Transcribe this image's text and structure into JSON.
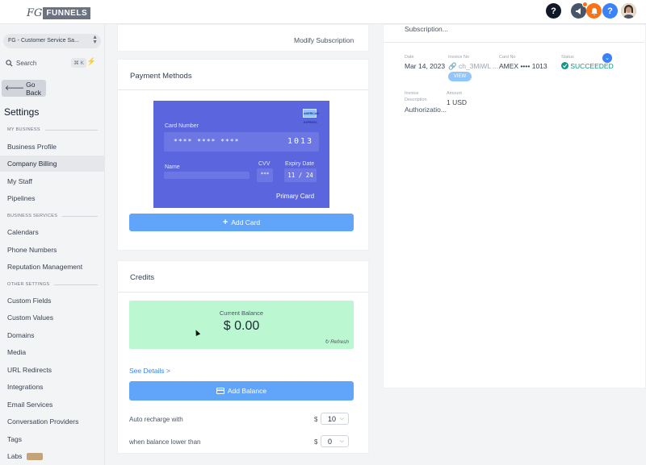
{
  "header": {
    "logo_fg": "FG",
    "logo_text": "FUNNELS",
    "help_icon": "?",
    "megaphone_icon": "megaphone-icon",
    "bell_icon": "bell-icon",
    "help2_icon": "?",
    "avatar": "avatar"
  },
  "sidebar": {
    "account": "FG - Customer Service Sa...",
    "search_label": "Search",
    "search_kbd": "⌘ K",
    "back_label": "Go Back",
    "settings_title": "Settings",
    "section_my_business": "MY BUSINESS",
    "section_business_services": "BUSINESS SERVICES",
    "section_other_settings": "OTHER SETTINGS",
    "items": {
      "business_profile": "Business Profile",
      "company_billing": "Company Billing",
      "my_staff": "My Staff",
      "pipelines": "Pipelines",
      "calendars": "Calendars",
      "phone_numbers": "Phone Numbers",
      "reputation_management": "Reputation Management",
      "custom_fields": "Custom Fields",
      "custom_values": "Custom Values",
      "domains": "Domains",
      "media": "Media",
      "url_redirects": "URL Redirects",
      "integrations": "Integrations",
      "email_services": "Email Services",
      "conversation_providers": "Conversation Providers",
      "tags": "Tags",
      "labs": "Labs"
    }
  },
  "subscription": {
    "modify_link": "Modify Subscription"
  },
  "payment_methods": {
    "title": "Payment Methods",
    "card": {
      "card_number_label": "Card Number",
      "masked_groups": "****   ****   ****",
      "last_four": "1013",
      "name_label": "Name",
      "cvv_label": "CVV",
      "cvv_value": "***",
      "expiry_label": "Expiry Date",
      "expiry_value": "11 / 24",
      "primary_label": "Primary Card",
      "brand": "AMERICAN EXPRESS"
    },
    "add_card_label": "Add Card"
  },
  "credits": {
    "title": "Credits",
    "current_balance_label": "Current Balance",
    "current_balance_value": "$ 0.00",
    "refresh_label": "Refresh",
    "see_details": "See Details >",
    "add_balance_label": "Add Balance",
    "auto_recharge_label": "Auto recharge with",
    "auto_recharge_currency": "$",
    "auto_recharge_value": "10",
    "lower_than_label": "when balance lower than",
    "lower_than_currency": "$",
    "lower_than_value": "0"
  },
  "transaction": {
    "top_text": "Subscription...",
    "date_label": "Date",
    "date_value": "Mar 14, 2023",
    "invoice_label": "Invoice No",
    "invoice_value": "ch_3MiWL ...",
    "view_label": "VIEW",
    "card_label": "Card No",
    "card_value": "AMEX •••• 1013",
    "status_label": "Status",
    "status_value": "SUCCEEDED",
    "desc_label_1": "Invoice",
    "desc_label_2": "Description",
    "desc_value": "Authorizatio...",
    "amount_label": "Amount",
    "amount_value": "1 USD"
  },
  "colors": {
    "card_blue": "#5b66de",
    "button_blue": "#60a5fa",
    "balance_green": "#bbf7d0",
    "status_teal": "#0f9488"
  }
}
